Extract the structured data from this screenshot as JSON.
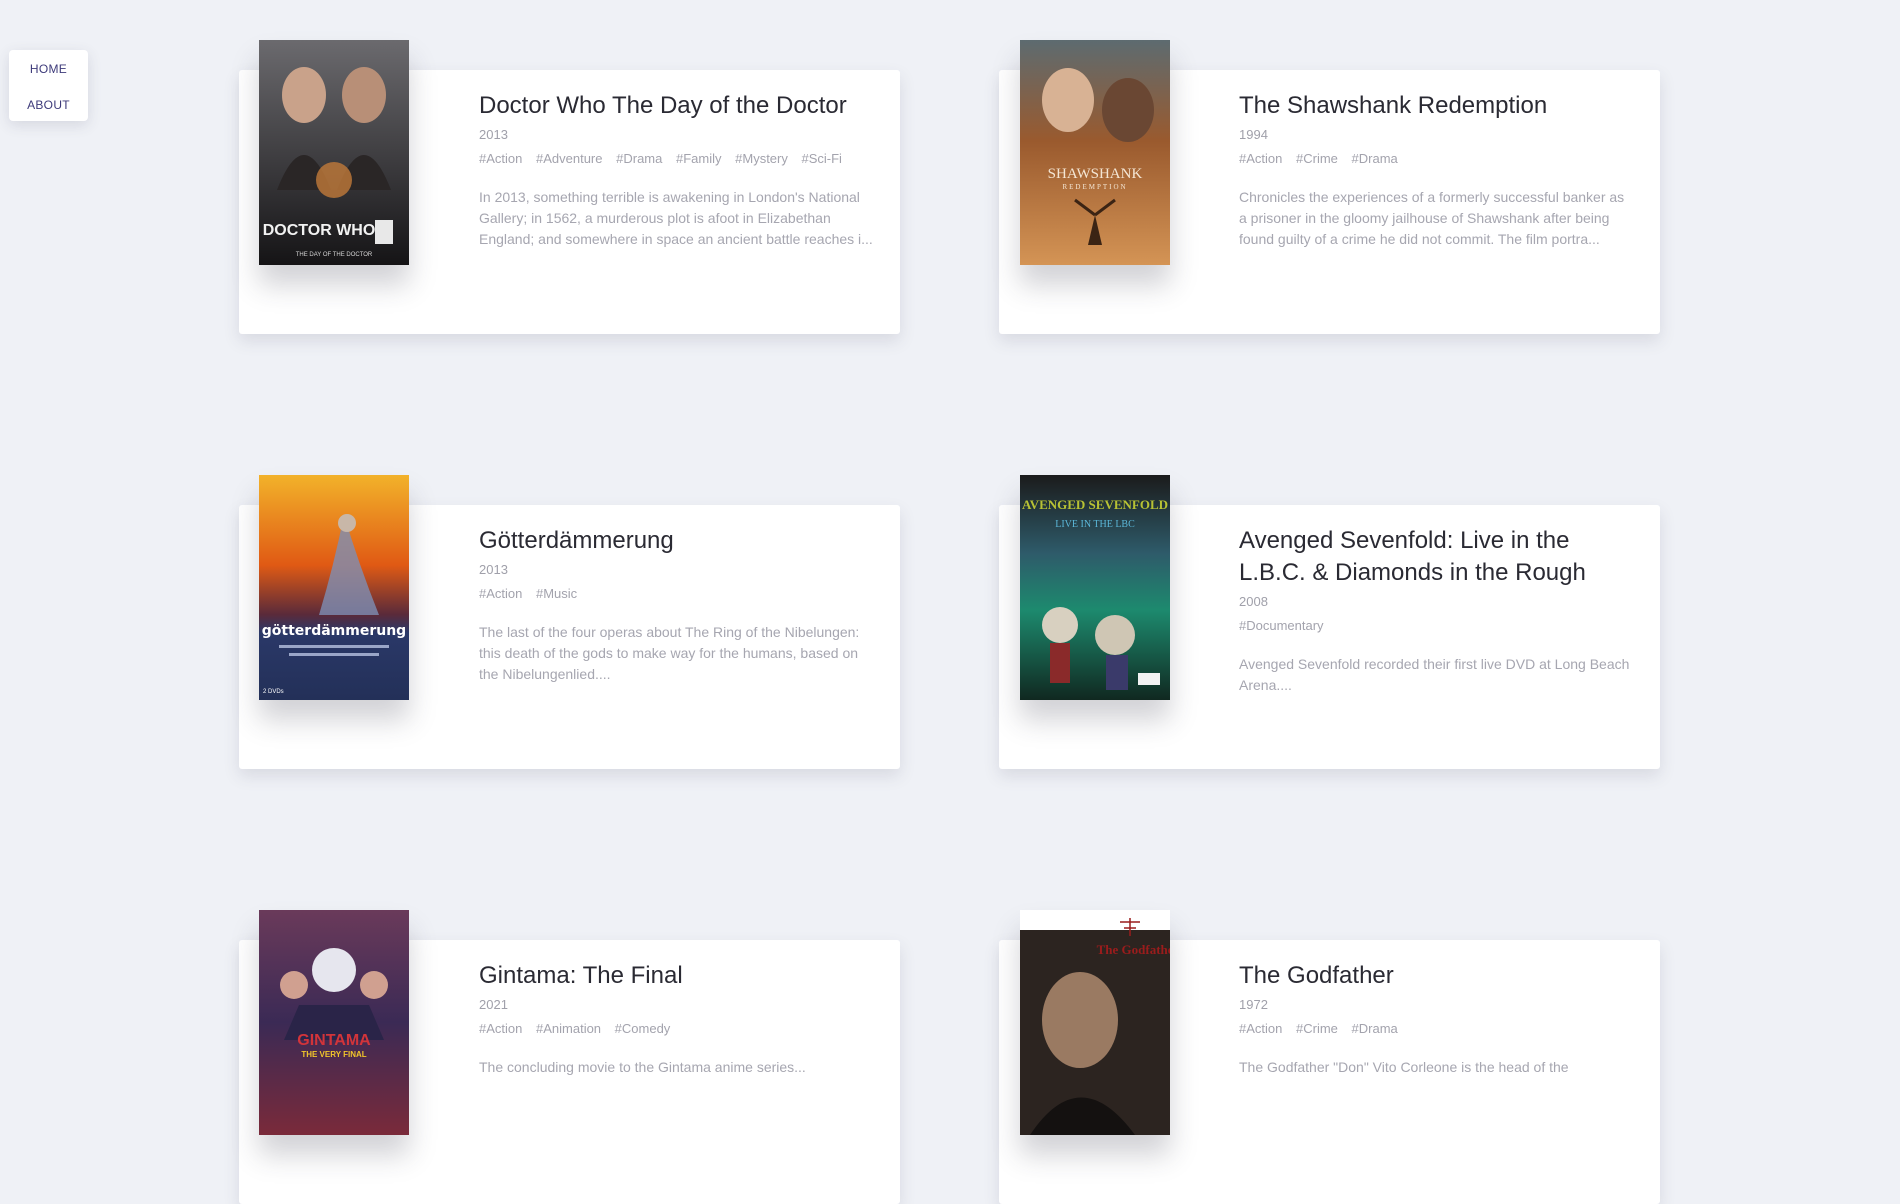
{
  "nav": {
    "home_label": "HOME",
    "about_label": "ABOUT"
  },
  "movies": [
    {
      "title": "Doctor Who The Day of the Doctor",
      "year": "2013",
      "tags": [
        "#Action",
        "#Adventure",
        "#Drama",
        "#Family",
        "#Mystery",
        "#Sci-Fi"
      ],
      "description": "In 2013, something terrible is awakening in London's National Gallery; in 1562, a murderous plot is afoot in Elizabethan England; and somewhere in space an ancient battle reaches i...",
      "poster": {
        "caption": "DOCTOR WHO",
        "subcaption": "THE DAY OF THE DOCTOR",
        "bg": "#3c3b3e",
        "accent": "#c27a3a"
      }
    },
    {
      "title": "The Shawshank Redemption",
      "year": "1994",
      "tags": [
        "#Action",
        "#Crime",
        "#Drama"
      ],
      "description": "Chronicles the experiences of a formerly successful banker as a prisoner in the gloomy jailhouse of Shawshank after being found guilty of a crime he did not commit. The film portra...",
      "poster": {
        "caption": "SHAWSHANK",
        "subcaption": "REDEMPTION",
        "bg": "#9a5a2e",
        "accent": "#d49455"
      }
    },
    {
      "title": "Götterdämmerung",
      "year": "2013",
      "tags": [
        "#Action",
        "#Music"
      ],
      "description": "The last of the four operas about The Ring of the Nibelungen: this death of the gods to make way for the humans, based on the Nibelungenlied....",
      "poster": {
        "caption": "götterdämmerung",
        "subcaption": "2 DVDs",
        "bg": "#2a3868",
        "accent": "#e05a14"
      }
    },
    {
      "title": "Avenged Sevenfold: Live in the L.B.C. & Diamonds in the Rough",
      "year": "2008",
      "tags": [
        "#Documentary"
      ],
      "description": "Avenged Sevenfold recorded their first live DVD at Long Beach Arena....",
      "poster": {
        "caption": "AVENGED SEVENFOLD",
        "subcaption": "LIVE IN THE LBC",
        "bg": "#1d3a33",
        "accent": "#b8c234"
      }
    },
    {
      "title": "Gintama: The Final",
      "year": "2021",
      "tags": [
        "#Action",
        "#Animation",
        "#Comedy"
      ],
      "description": "The concluding movie to the Gintama anime series...",
      "poster": {
        "caption": "GINTAMA",
        "subcaption": "THE VERY FINAL",
        "bg": "#3b2a55",
        "accent": "#d2343a"
      }
    },
    {
      "title": "The Godfather",
      "year": "1972",
      "tags": [
        "#Action",
        "#Crime",
        "#Drama"
      ],
      "description": "The Godfather \"Don\" Vito Corleone is the head of the",
      "poster": {
        "caption": "The Godfather",
        "subcaption": "",
        "bg": "#2c2420",
        "accent": "#9a1c1c"
      }
    }
  ]
}
